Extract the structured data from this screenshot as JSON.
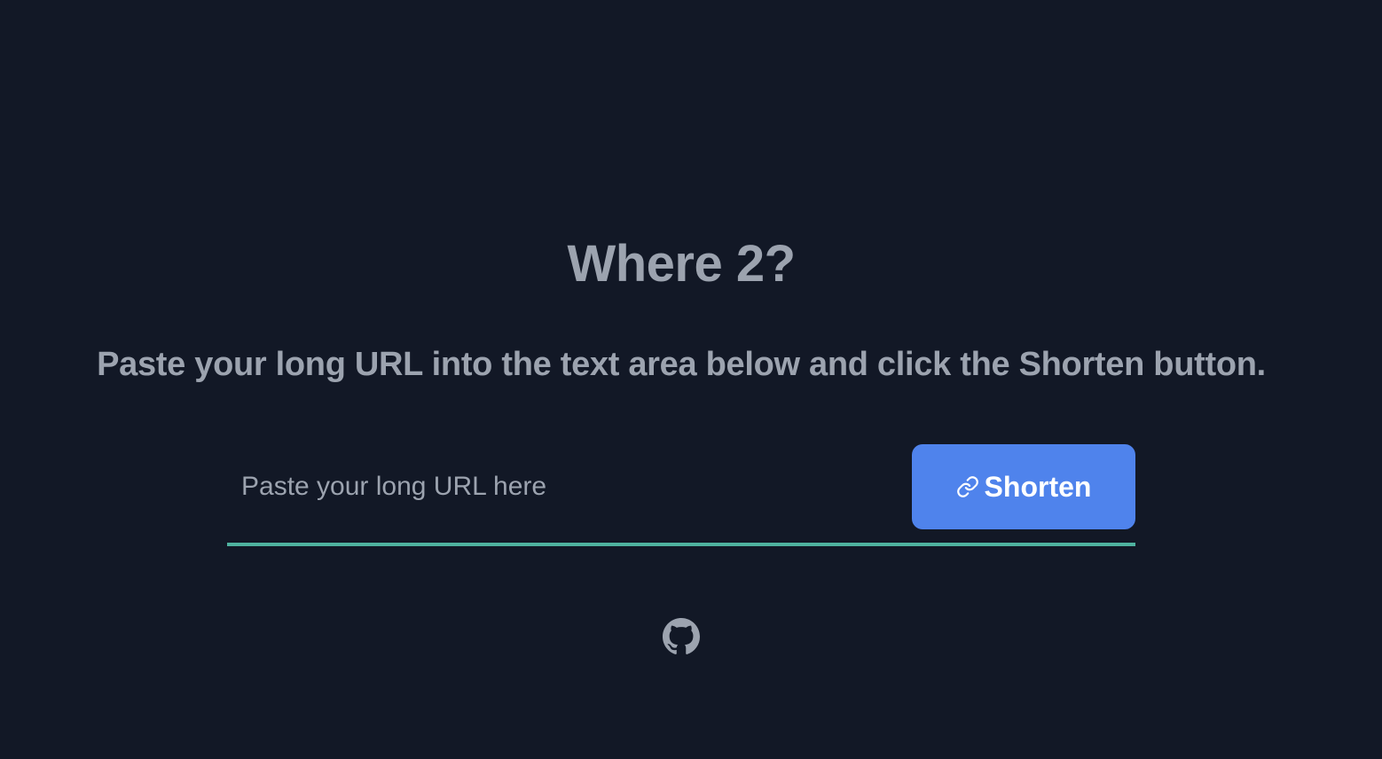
{
  "header": {
    "title": "Where 2?",
    "subtitle": "Paste your long URL into the text area below and click the Shorten button."
  },
  "form": {
    "url_input": {
      "value": "",
      "placeholder": "Paste your long URL here"
    },
    "shorten_label": "Shorten",
    "shorten_icon": "link-icon"
  },
  "footer": {
    "github_icon": "github-icon"
  },
  "colors": {
    "background": "#121826",
    "text_muted": "#9ca3af",
    "accent_button": "#4f83ec",
    "underline": "#4fb2a0",
    "button_text": "#ffffff"
  }
}
